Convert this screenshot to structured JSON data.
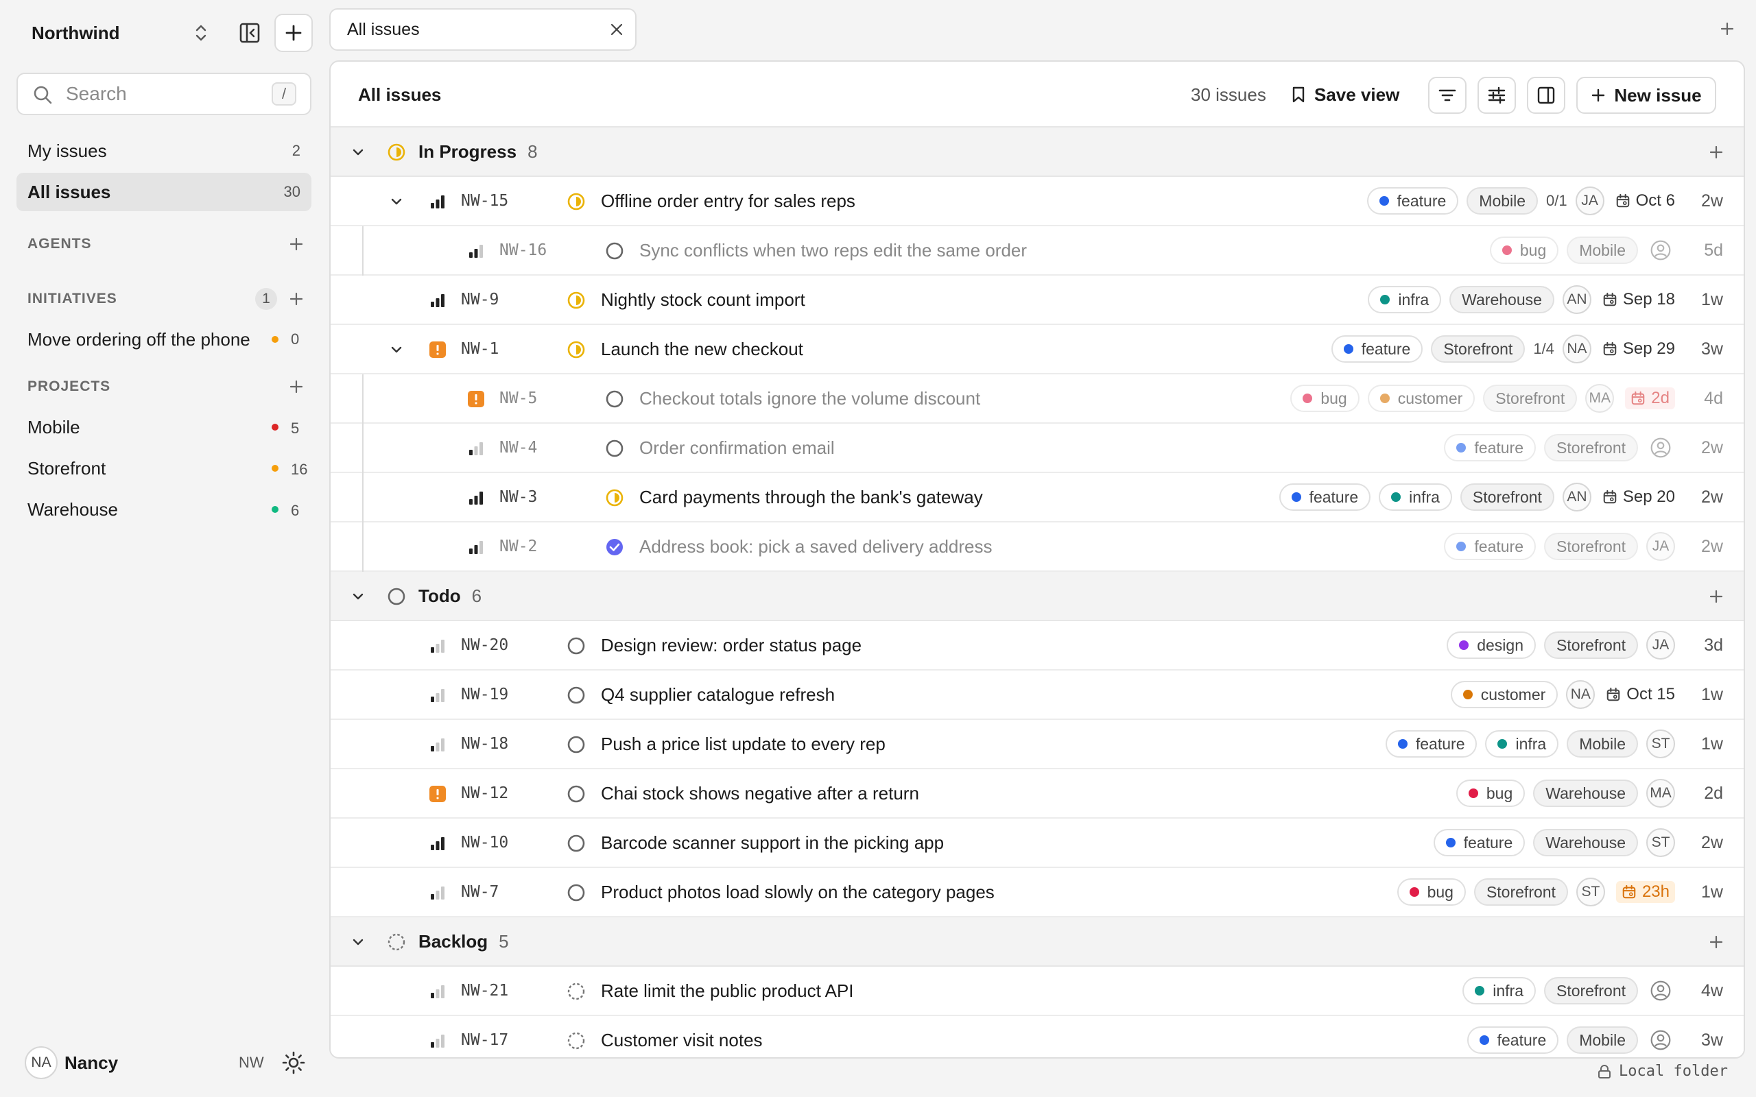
{
  "sidebar": {
    "workspace": "Northwind",
    "search_placeholder": "Search",
    "search_shortcut": "/",
    "nav": [
      {
        "label": "My issues",
        "count": "2"
      },
      {
        "label": "All issues",
        "count": "30"
      }
    ],
    "agents_label": "AGENTS",
    "initiatives_label": "INITIATIVES",
    "initiatives_count": "1",
    "initiatives": [
      {
        "label": "Move ordering off the phone",
        "count": "0",
        "color": "#f59e0b"
      }
    ],
    "projects_label": "PROJECTS",
    "projects": [
      {
        "label": "Mobile",
        "count": "5",
        "color": "#dc2626"
      },
      {
        "label": "Storefront",
        "count": "16",
        "color": "#f59e0b"
      },
      {
        "label": "Warehouse",
        "count": "6",
        "color": "#10b981"
      }
    ],
    "user": {
      "initials": "NA",
      "name": "Nancy",
      "workspace_short": "NW"
    }
  },
  "tabs": [
    {
      "label": "All issues"
    }
  ],
  "header": {
    "title": "All issues",
    "count": "30 issues",
    "save_view": "Save view",
    "new_issue": "New issue"
  },
  "label_colors": {
    "feature": "#2563eb",
    "bug": "#e11d48",
    "infra": "#0d9488",
    "customer": "#d97706",
    "design": "#9333ea"
  },
  "groups": [
    {
      "name": "In Progress",
      "count": "8",
      "status": "in-progress",
      "issues": [
        {
          "id": "NW-15",
          "title": "Offline order entry for sales reps",
          "priority": "high",
          "status": "in-progress",
          "expanded": true,
          "labels": [
            "feature"
          ],
          "project": "Mobile",
          "subcount": "0/1",
          "assignee": "JA",
          "due": "Oct 6",
          "age": "2w",
          "level": 0
        },
        {
          "id": "NW-16",
          "title": "Sync conflicts when two reps edit the same order",
          "priority": "medium",
          "status": "todo",
          "labels": [
            "bug"
          ],
          "project": "Mobile",
          "assignee": "",
          "age": "5d",
          "level": 1,
          "dim": true
        },
        {
          "id": "NW-9",
          "title": "Nightly stock count import",
          "priority": "high",
          "status": "in-progress",
          "labels": [
            "infra"
          ],
          "project": "Warehouse",
          "assignee": "AN",
          "due": "Sep 18",
          "age": "1w",
          "level": 0
        },
        {
          "id": "NW-1",
          "title": "Launch the new checkout",
          "priority": "urgent",
          "status": "in-progress",
          "expanded": true,
          "labels": [
            "feature"
          ],
          "project": "Storefront",
          "subcount": "1/4",
          "assignee": "NA",
          "due": "Sep 29",
          "age": "3w",
          "level": 0
        },
        {
          "id": "NW-5",
          "title": "Checkout totals ignore the volume discount",
          "priority": "urgent",
          "status": "todo",
          "labels": [
            "bug",
            "customer"
          ],
          "project": "Storefront",
          "assignee": "MA",
          "due": "2d",
          "due_style": "red",
          "age": "4d",
          "level": 1,
          "dim": true
        },
        {
          "id": "NW-4",
          "title": "Order confirmation email",
          "priority": "low",
          "status": "todo",
          "labels": [
            "feature"
          ],
          "project": "Storefront",
          "assignee": "",
          "age": "2w",
          "level": 1,
          "dim": true
        },
        {
          "id": "NW-3",
          "title": "Card payments through the bank's gateway",
          "priority": "high",
          "status": "in-progress",
          "labels": [
            "feature",
            "infra"
          ],
          "project": "Storefront",
          "assignee": "AN",
          "due": "Sep 20",
          "age": "2w",
          "level": 1
        },
        {
          "id": "NW-2",
          "title": "Address book: pick a saved delivery address",
          "priority": "medium",
          "status": "done",
          "labels": [
            "feature"
          ],
          "project": "Storefront",
          "assignee": "JA",
          "age": "2w",
          "level": 1,
          "dim": true
        }
      ]
    },
    {
      "name": "Todo",
      "count": "6",
      "status": "todo",
      "issues": [
        {
          "id": "NW-20",
          "title": "Design review: order status page",
          "priority": "low",
          "status": "todo",
          "labels": [
            "design"
          ],
          "project": "Storefront",
          "assignee": "JA",
          "age": "3d",
          "level": 0
        },
        {
          "id": "NW-19",
          "title": "Q4 supplier catalogue refresh",
          "priority": "low",
          "status": "todo",
          "labels": [
            "customer"
          ],
          "project": "",
          "assignee": "NA",
          "due": "Oct 15",
          "age": "1w",
          "level": 0
        },
        {
          "id": "NW-18",
          "title": "Push a price list update to every rep",
          "priority": "low",
          "status": "todo",
          "labels": [
            "feature",
            "infra"
          ],
          "project": "Mobile",
          "assignee": "ST",
          "age": "1w",
          "level": 0
        },
        {
          "id": "NW-12",
          "title": "Chai stock shows negative after a return",
          "priority": "urgent",
          "status": "todo",
          "labels": [
            "bug"
          ],
          "project": "Warehouse",
          "assignee": "MA",
          "age": "2d",
          "level": 0
        },
        {
          "id": "NW-10",
          "title": "Barcode scanner support in the picking app",
          "priority": "high",
          "status": "todo",
          "labels": [
            "feature"
          ],
          "project": "Warehouse",
          "assignee": "ST",
          "age": "2w",
          "level": 0
        },
        {
          "id": "NW-7",
          "title": "Product photos load slowly on the category pages",
          "priority": "low",
          "status": "todo",
          "labels": [
            "bug"
          ],
          "project": "Storefront",
          "assignee": "ST",
          "due": "23h",
          "due_style": "orange",
          "age": "1w",
          "level": 0
        }
      ]
    },
    {
      "name": "Backlog",
      "count": "5",
      "status": "backlog",
      "issues": [
        {
          "id": "NW-21",
          "title": "Rate limit the public product API",
          "priority": "low",
          "status": "backlog",
          "labels": [
            "infra"
          ],
          "project": "Storefront",
          "assignee": "",
          "age": "4w",
          "level": 0
        },
        {
          "id": "NW-17",
          "title": "Customer visit notes",
          "priority": "low",
          "status": "backlog",
          "labels": [
            "feature"
          ],
          "project": "Mobile",
          "assignee": "",
          "age": "3w",
          "level": 0
        }
      ]
    }
  ],
  "footer": {
    "label": "Local folder"
  }
}
